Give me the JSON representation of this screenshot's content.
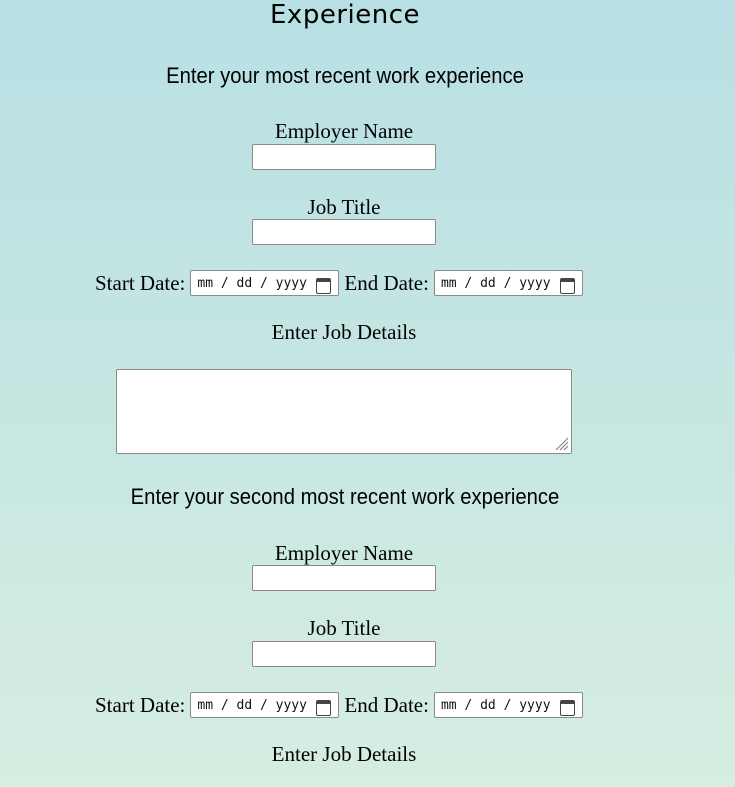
{
  "page": {
    "title": "Experience"
  },
  "experience_1": {
    "heading": "Enter your most recent work experience",
    "employer_label": "Employer Name",
    "employer_value": "",
    "job_title_label": "Job Title",
    "job_title_value": "",
    "start_date_label": "Start Date:",
    "start_date_value": "mm / dd / yyyy",
    "end_date_label": "End Date:",
    "end_date_value": "mm / dd / yyyy",
    "details_label": "Enter Job Details",
    "details_value": ""
  },
  "experience_2": {
    "heading": "Enter your second most recent work experience",
    "employer_label": "Employer Name",
    "employer_value": "",
    "job_title_label": "Job Title",
    "job_title_value": "",
    "start_date_label": "Start Date:",
    "start_date_value": "mm / dd / yyyy",
    "end_date_label": "End Date:",
    "end_date_value": "mm / dd / yyyy",
    "details_label": "Enter Job Details"
  },
  "icons": {
    "calendar": "calendar-icon",
    "resize": "resize-grip-icon"
  },
  "colors": {
    "background_top": "#b8e0e4",
    "background_bottom": "#d6ede1",
    "input_border": "#8a8a8a"
  }
}
